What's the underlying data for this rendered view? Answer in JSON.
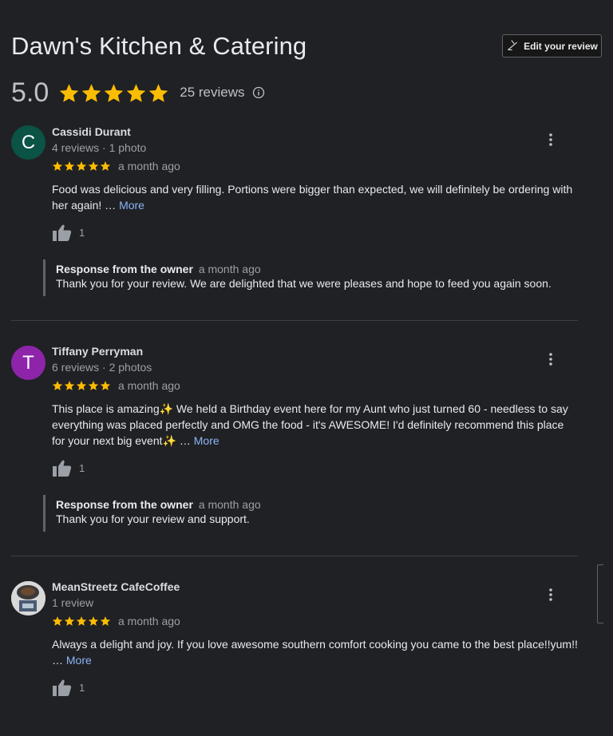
{
  "business": {
    "name": "Dawn's Kitchen & Catering",
    "edit_review_label": "Edit your review",
    "rating": "5.0",
    "review_count": "25 reviews",
    "star_color": "#fbbc04"
  },
  "reviews": [
    {
      "avatar_letter": "C",
      "avatar_color": "#0b5345",
      "name": "Cassidi Durant",
      "meta": "4 reviews · 1 photo",
      "stars": 5,
      "date": "a month ago",
      "text": "Food was delicious and very filling. Portions were bigger than expected, we will definitely be ordering with her again! …",
      "more_label": "More",
      "likes": "1",
      "response": {
        "label": "Response from the owner",
        "date": "a month ago",
        "text": "Thank you for your review. We are delighted that we were pleases and hope to feed you again soon."
      }
    },
    {
      "avatar_letter": "T",
      "avatar_color": "#8e24aa",
      "name": "Tiffany Perryman",
      "meta": "6 reviews · 2 photos",
      "stars": 5,
      "date": "a month ago",
      "text": "This place is amazing✨ We held a Birthday event here for my Aunt who just turned 60 - needless to say everything was placed perfectly and OMG the food - it's AWESOME! I'd definitely recommend this place for your next big event✨ …",
      "more_label": "More",
      "likes": "1",
      "response": {
        "label": "Response from the owner",
        "date": "a month ago",
        "text": "Thank you for your review and support."
      }
    },
    {
      "avatar_letter": "",
      "avatar_color": "#dcdcdc",
      "name": "MeanStreetz CafeCoffee",
      "meta": "1 review",
      "stars": 5,
      "date": "a month ago",
      "text": "Always a delight and joy. If you love awesome southern comfort cooking you came to the best place!!yum!! …",
      "more_label": "More",
      "likes": "1"
    }
  ]
}
